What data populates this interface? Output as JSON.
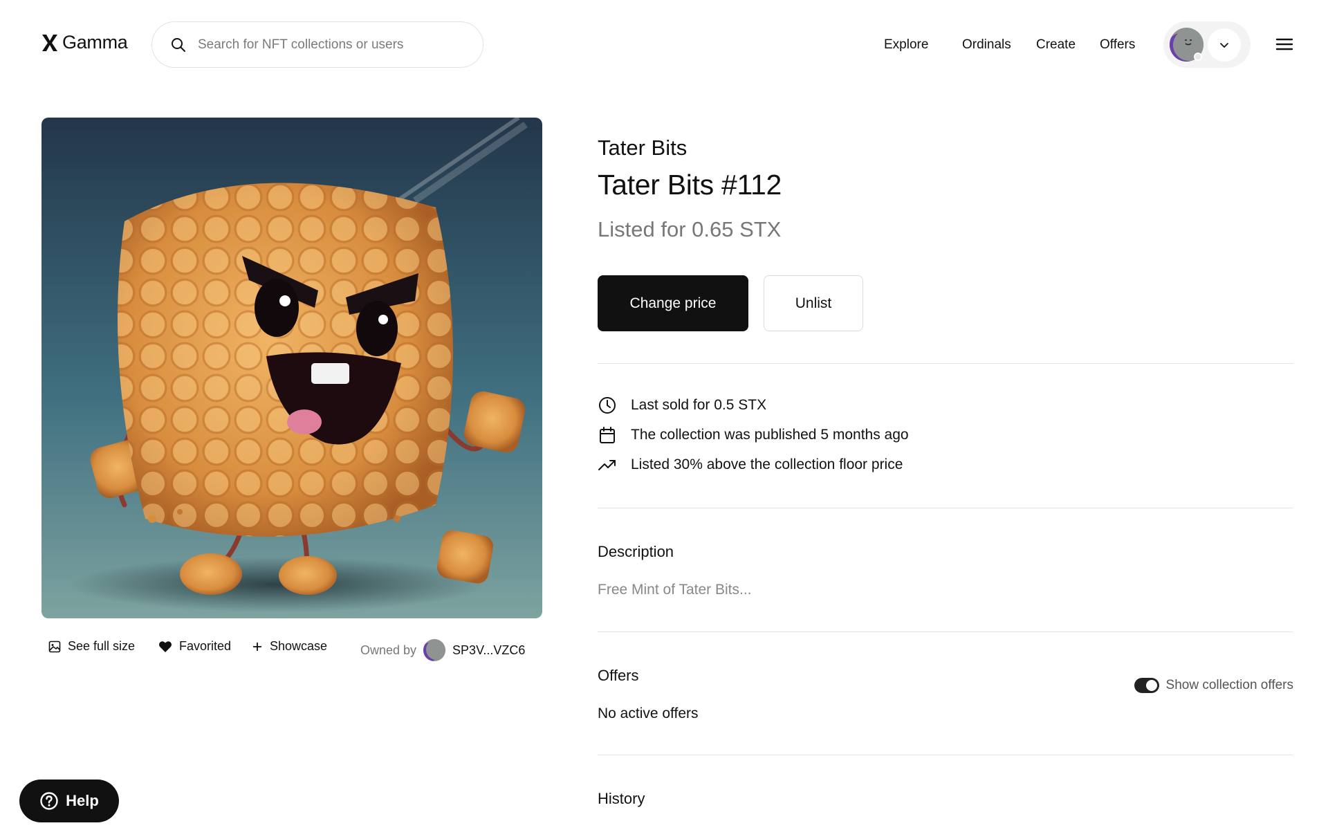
{
  "header": {
    "brand": "Gamma",
    "search_placeholder": "Search for NFT collections or users",
    "nav": [
      "Explore",
      "Ordinals",
      "Create",
      "Offers"
    ]
  },
  "image_actions": {
    "see_full_size": "See full size",
    "favorited": "Favorited",
    "showcase": "Showcase",
    "owned_by": "Owned by",
    "owner": "SP3V...VZC6"
  },
  "item": {
    "collection": "Tater Bits",
    "title": "Tater Bits #112",
    "listed": "Listed for 0.65 STX",
    "change_price": "Change price",
    "unlist": "Unlist"
  },
  "facts": [
    {
      "icon": "clock-icon",
      "text": "Last sold for 0.5 STX"
    },
    {
      "icon": "calendar-icon",
      "text": "The collection was published 5 months ago"
    },
    {
      "icon": "trending-up-icon",
      "text": "Listed 30% above the collection floor price"
    }
  ],
  "description": {
    "title": "Description",
    "text": "Free Mint of Tater Bits..."
  },
  "offers": {
    "title": "Offers",
    "toggle_label": "Show collection offers",
    "toggle_on": true,
    "empty": "No active offers"
  },
  "history": {
    "title": "History"
  },
  "help": {
    "label": "Help"
  },
  "colors": {
    "primary": "#111111",
    "muted": "#777777",
    "avatar_accent": "#6a3fb0"
  }
}
